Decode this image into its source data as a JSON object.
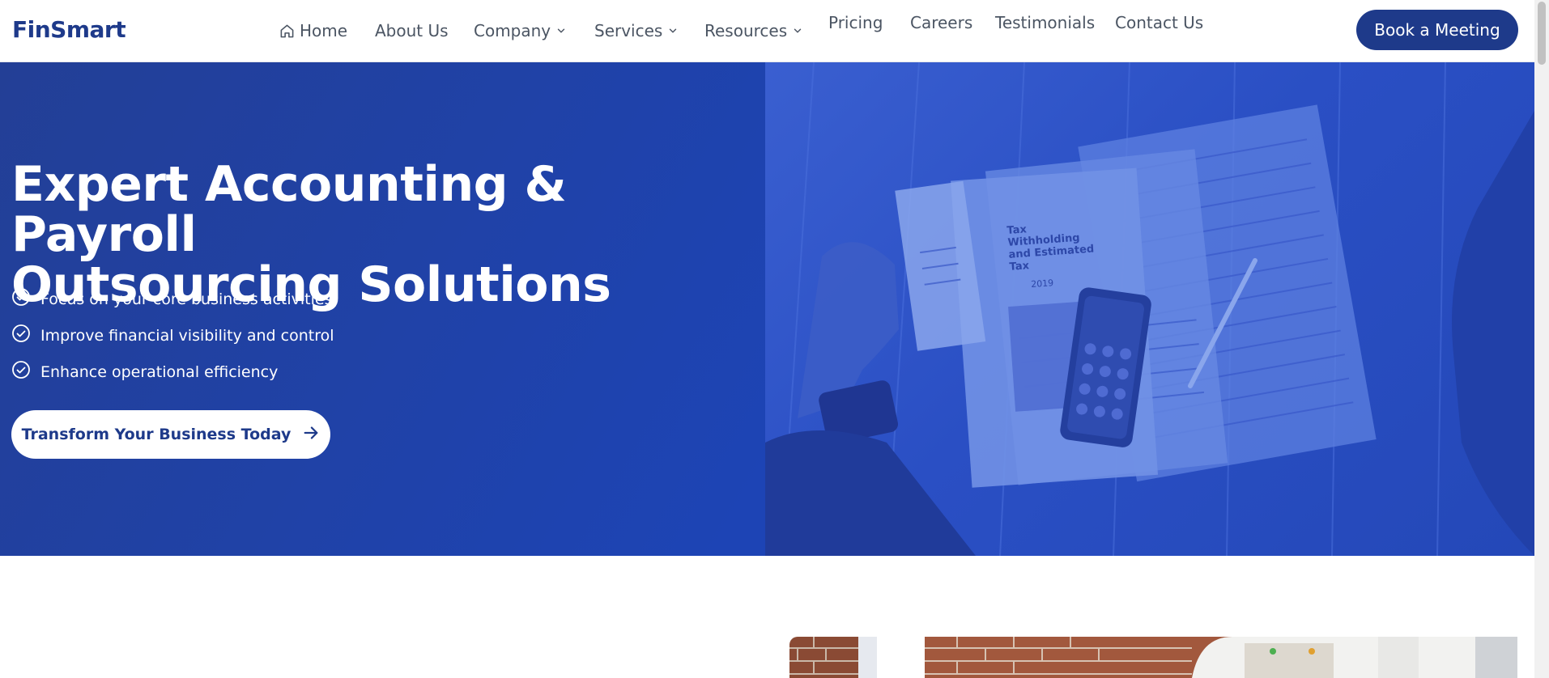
{
  "header": {
    "logo": "FinSmart",
    "nav": [
      {
        "label": "Home",
        "icon": "home-icon"
      },
      {
        "label": "About Us"
      },
      {
        "label": "Company",
        "icon": "chevron-down-icon"
      },
      {
        "label": "Services",
        "icon": "chevron-down-icon"
      },
      {
        "label": "Resources",
        "icon": "chevron-down-icon"
      },
      {
        "label": "Pricing"
      },
      {
        "label": "Careers"
      },
      {
        "label": "Testimonials"
      },
      {
        "label": "Contact Us"
      }
    ],
    "cta_label": "Book a Meeting"
  },
  "hero": {
    "title_line1": "Expert Accounting & Payroll",
    "title_line2": "Outsourcing Solutions",
    "features": [
      "Focus on your core business activities",
      "Improve financial visibility and control",
      "Enhance operational efficiency"
    ],
    "button_label": "Transform Your Business Today",
    "button_icon": "arrow-right-icon"
  },
  "photo": {
    "form_title_1": "Tax",
    "form_title_2": "Withholding",
    "form_title_3": "and Estimated",
    "form_title_4": "Tax",
    "form_year": "2019"
  },
  "colors": {
    "brand": "#1e3a8a",
    "hero_bg": "#1d44b5",
    "white": "#ffffff"
  }
}
